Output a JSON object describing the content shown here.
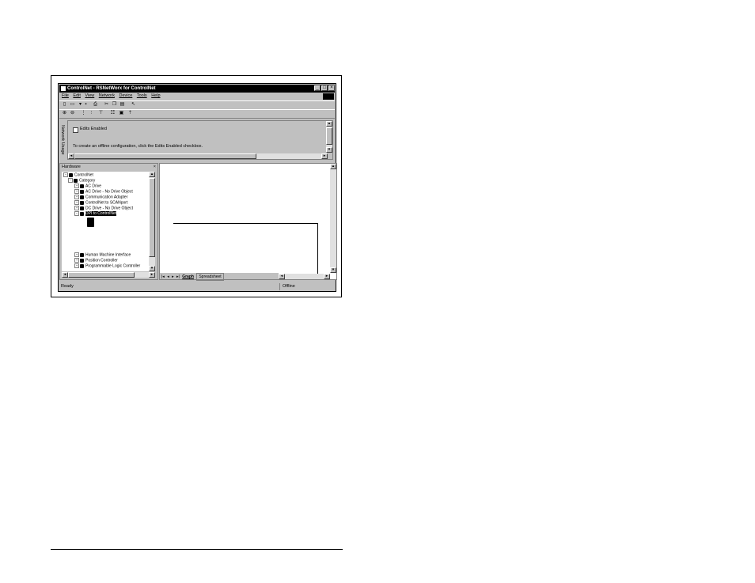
{
  "window": {
    "title": "ControlNet - RSNetWorx for ControlNet"
  },
  "menu": [
    "File",
    "Edit",
    "View",
    "Network",
    "Device",
    "Tools",
    "Help"
  ],
  "log": {
    "side_label": "Network Usage",
    "checkbox_label": "Edits Enabled",
    "message": "To create an offline configuration, click the Edits Enabled checkbox."
  },
  "hardware": {
    "title": "Hardware",
    "root": "ControlNet",
    "category": "Category",
    "items": [
      {
        "label": "AC Drive"
      },
      {
        "label": "AC Drive - No Drive Object"
      },
      {
        "label": "Communication Adapter"
      },
      {
        "label": "ControlNet to SCANport"
      },
      {
        "label": "DC Drive - No Drive Object"
      },
      {
        "label": "DPI to ControlNet",
        "selected": true
      },
      {
        "label": "Human Machine Interface"
      },
      {
        "label": "Position Controller"
      },
      {
        "label": "Programmable Logic Controller"
      }
    ]
  },
  "tabs": [
    "Graph",
    "Spreadsheet"
  ],
  "status": {
    "left": "Ready",
    "right": "Offline"
  }
}
